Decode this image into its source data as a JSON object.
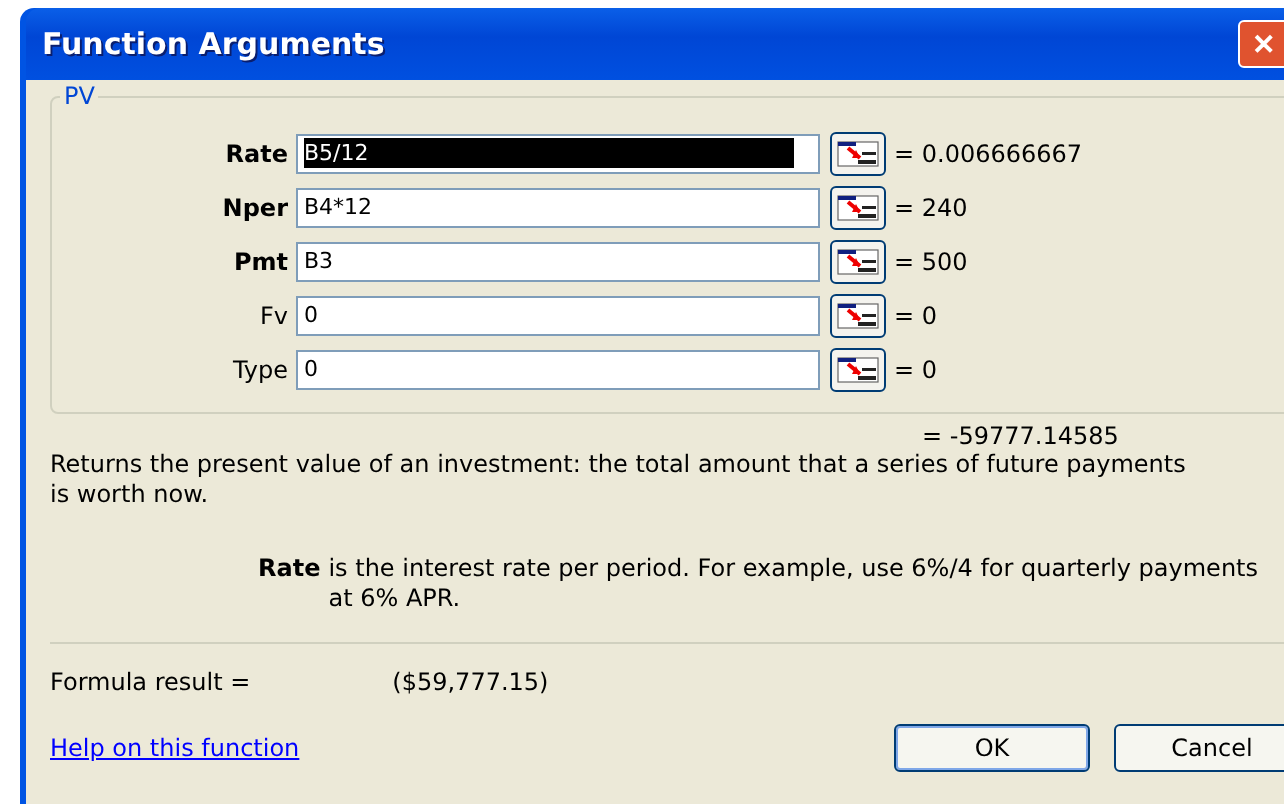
{
  "window": {
    "title": "Function Arguments",
    "close": "✕"
  },
  "group": {
    "title": "PV"
  },
  "arguments": [
    {
      "label": "Rate",
      "required": true,
      "value": "B5/12",
      "selected": true,
      "result": "= 0.006666667"
    },
    {
      "label": "Nper",
      "required": true,
      "value": "B4*12",
      "selected": false,
      "result": "= 240"
    },
    {
      "label": "Pmt",
      "required": true,
      "value": "B3",
      "selected": false,
      "result": "= 500"
    },
    {
      "label": "Fv",
      "required": false,
      "value": "0",
      "selected": false,
      "result": "= 0"
    },
    {
      "label": "Type",
      "required": false,
      "value": "0",
      "selected": false,
      "result": "= 0"
    }
  ],
  "function_result": "= -59777.14585",
  "description": "Returns the present value of an investment: the total amount that a series of future payments is worth now.",
  "argument_help": {
    "name": "Rate",
    "text": "is the interest rate per period. For example, use 6%/4 for quarterly payments at 6% APR."
  },
  "formula_result": {
    "label": "Formula result =",
    "value": "($59,777.15)"
  },
  "help_link": "Help on this function",
  "buttons": [
    "OK",
    "Cancel"
  ]
}
